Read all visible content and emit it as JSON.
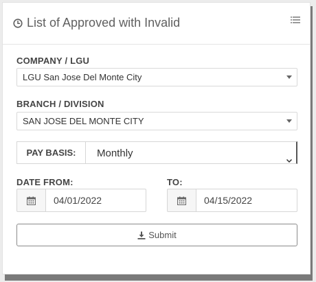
{
  "panel": {
    "title": "List of Approved with Invalid",
    "title_icon": "clock-icon",
    "menu_icon": "list-icon"
  },
  "company": {
    "label": "COMPANY / LGU",
    "selected": "LGU San Jose Del Monte City"
  },
  "branch": {
    "label": "BRANCH / DIVISION",
    "selected": "SAN JOSE DEL MONTE CITY"
  },
  "pay_basis": {
    "label": "PAY BASIS:",
    "selected": "Monthly"
  },
  "date_from": {
    "label": "DATE FROM:",
    "value": "04/01/2022",
    "icon": "calendar-icon"
  },
  "date_to": {
    "label": "TO:",
    "value": "04/15/2022",
    "icon": "calendar-icon"
  },
  "submit": {
    "label": "Submit",
    "icon": "download-icon"
  },
  "colors": {
    "background": "#ececec",
    "panel": "#ffffff",
    "border": "#d6d6d6",
    "text": "#333333"
  }
}
